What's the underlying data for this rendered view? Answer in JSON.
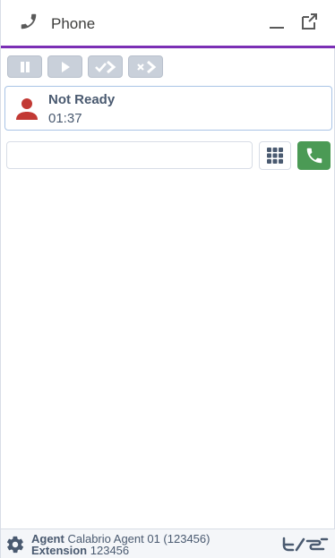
{
  "header": {
    "title": "Phone",
    "icon": "phone-icon",
    "minimize_icon": "minimize-icon",
    "popout_icon": "popout-icon",
    "accent_color": "#7b2fb5"
  },
  "toolbar": {
    "buttons": [
      {
        "name": "hold",
        "icon": "pause-icon",
        "enabled": false
      },
      {
        "name": "resume",
        "icon": "play-icon",
        "enabled": false
      },
      {
        "name": "consult-transfer",
        "icon": "check-arrow-icon",
        "enabled": false
      },
      {
        "name": "blind-transfer",
        "icon": "x-arrow-icon",
        "enabled": false
      }
    ]
  },
  "status": {
    "label": "Not Ready",
    "timer": "01:37",
    "icon": "person-icon",
    "icon_color": "#c23934"
  },
  "dialer": {
    "value": "",
    "placeholder": "",
    "keypad_icon": "keypad-icon",
    "call_icon": "phone-icon",
    "call_color": "#4b9a55"
  },
  "footer": {
    "agent_label": "Agent",
    "agent_value": "Calabrio Agent 01 (123456)",
    "extension_label": "Extension",
    "extension_value": "123456",
    "settings_icon": "gear-icon",
    "logo_icon": "company-logo"
  }
}
